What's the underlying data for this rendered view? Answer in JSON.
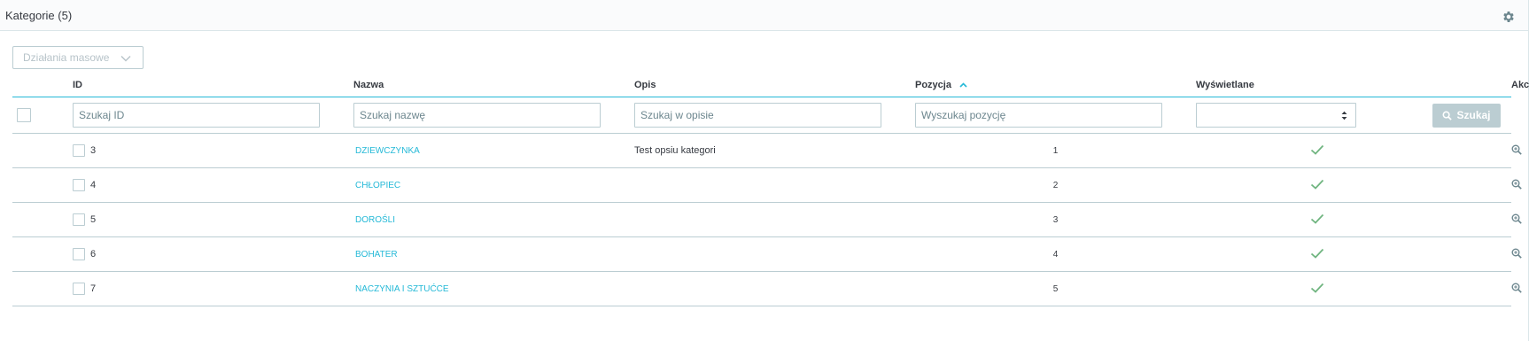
{
  "panel": {
    "title": "Kategorie (5)",
    "bulk_actions_label": "Działania masowe"
  },
  "columns": {
    "id": "ID",
    "name": "Nazwa",
    "description": "Opis",
    "position": "Pozycja",
    "displayed": "Wyświetlane",
    "actions": "Akcje"
  },
  "filters": {
    "id_placeholder": "Szukaj ID",
    "name_placeholder": "Szukaj nazwę",
    "description_placeholder": "Szukaj w opisie",
    "position_placeholder": "Wyszukaj pozycję",
    "displayed_value": "",
    "search_label": "Szukaj"
  },
  "rows": [
    {
      "id": "3",
      "name": "DZIEWCZYNKA",
      "description": "Test opsiu kategori",
      "position": "1",
      "displayed": true
    },
    {
      "id": "4",
      "name": "CHŁOPIEC",
      "description": "",
      "position": "2",
      "displayed": true
    },
    {
      "id": "5",
      "name": "DOROŚLI",
      "description": "",
      "position": "3",
      "displayed": true
    },
    {
      "id": "6",
      "name": "BOHATER",
      "description": "",
      "position": "4",
      "displayed": true
    },
    {
      "id": "7",
      "name": "NACZYNIA I SZTUĆCE",
      "description": "",
      "position": "5",
      "displayed": true
    }
  ],
  "colors": {
    "accent": "#25b9d7",
    "check": "#70b580",
    "border": "#bbcdd2"
  },
  "icons": {
    "settings": "gear-icon",
    "bulk_dropdown": "chevron-down-icon",
    "sort": "sort-asc-icon",
    "search": "search-icon",
    "view": "zoom-in-icon",
    "more": "kebab-icon",
    "displayed": "check-icon"
  }
}
